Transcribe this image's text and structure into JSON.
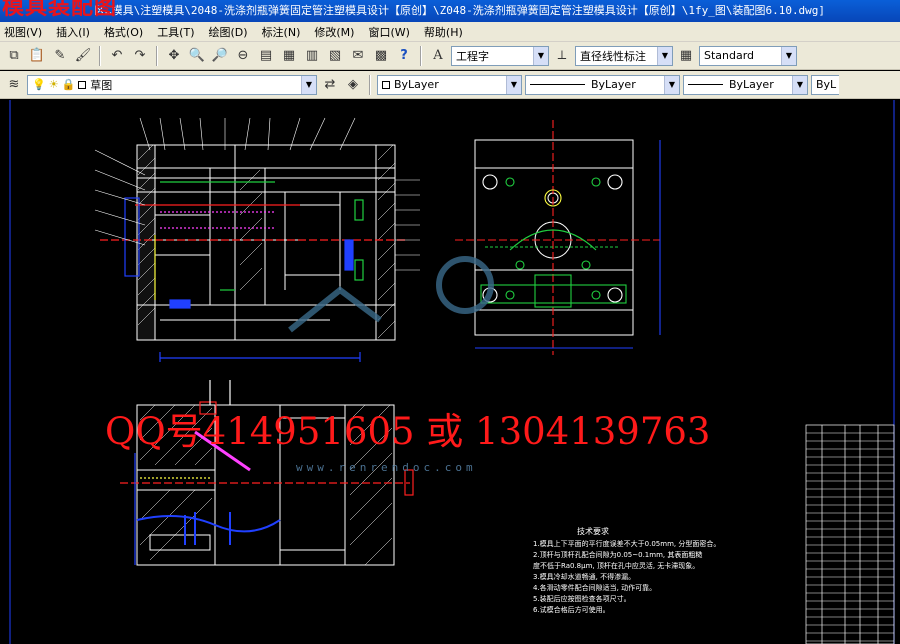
{
  "window": {
    "title": "区…模具\\注塑模具\\2048-洗涤剂瓶弹簧固定管注塑模具设计【原创】\\Z048-洗涤剂瓶弹簧固定管注塑模具设计【原创】\\1fy_图\\装配图6.10.dwg]",
    "watermark_title": "模具装配图"
  },
  "menu": {
    "items": [
      "视图(V)",
      "插入(I)",
      "格式(O)",
      "工具(T)",
      "绘图(D)",
      "标注(N)",
      "修改(M)",
      "窗口(W)",
      "帮助(H)"
    ]
  },
  "toolbar_styles": {
    "text_style": "工程字",
    "dim_style": "直径线性标注",
    "table_style": "Standard"
  },
  "toolbar_layers": {
    "layer_name": "草图",
    "color": "ByLayer",
    "linetype": "ByLayer",
    "lineweight": "ByLayer",
    "plotstyle": "ByL"
  },
  "drawing": {
    "watermark_contact": "QQ号414951605 或 1304139763",
    "watermark_site": "www.renrendoc.com",
    "tech_title": "技术要求",
    "tech_notes": [
      "1.模具上下平面的平行度误差不大于0.05mm, 分型面密合。",
      "2.顶杆与顶杆孔配合间隙为0.05~0.1mm, 其表面粗糙",
      "  度不低于Ra0.8μm, 顶杆在孔中应灵活, 无卡滞现象。",
      "3.模具冷却水道畅通, 不得渗漏。",
      "4.各滑动零件配合间隙适当, 动作可靠。",
      "5.装配后应按图检查各项尺寸。",
      "6.试模合格后方可使用。"
    ]
  },
  "colors": {
    "titlebar": "#0a5fd8",
    "toolbar": "#ece9d8",
    "canvas": "#000000",
    "cad_white": "#ffffff",
    "cad_red": "#ff2020",
    "cad_blue": "#2040ff",
    "cad_green": "#20d040",
    "cad_yellow": "#ffff40",
    "cad_magenta": "#ff40ff",
    "watermark_red": "#ff1a1a"
  }
}
